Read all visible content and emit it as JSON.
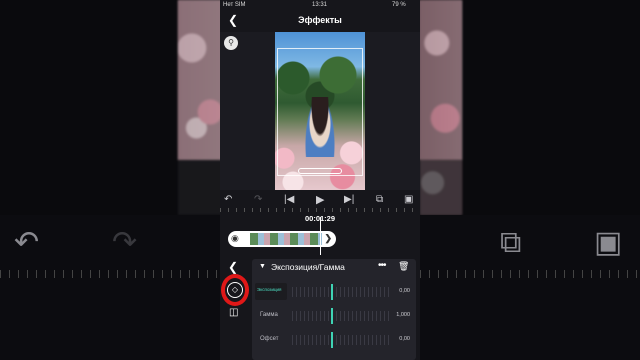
{
  "status_bar": {
    "carrier": "Нет SIM",
    "time": "13:31",
    "battery": "79 %"
  },
  "header": {
    "title": "Эффекты"
  },
  "timeline": {
    "timecode": "00:01:29"
  },
  "effect_panel": {
    "name": "Экспозиция/Гамма",
    "rows": [
      {
        "label": "Экспозиция",
        "value": "0,00",
        "active": true
      },
      {
        "label": "Гамма",
        "value": "1,000",
        "active": false
      },
      {
        "label": "Офсет",
        "value": "0,00",
        "active": false
      }
    ]
  },
  "icons": {
    "back": "chevron-left-icon",
    "zoom": "zoom-icon",
    "undo": "undo-icon",
    "redo": "redo-icon",
    "to_start": "skip-start-icon",
    "play": "play-icon",
    "to_end": "skip-end-icon",
    "copy": "copy-icon",
    "fit": "fit-screen-icon",
    "eye": "eye-icon",
    "keyframe": "keyframe-diamond-icon",
    "compare": "compare-icon",
    "more": "more-dots-icon",
    "trash": "trash-icon"
  },
  "colors": {
    "accent": "#3fd3b4",
    "highlight_circle": "#e01818",
    "panel_bg": "#24242b"
  }
}
